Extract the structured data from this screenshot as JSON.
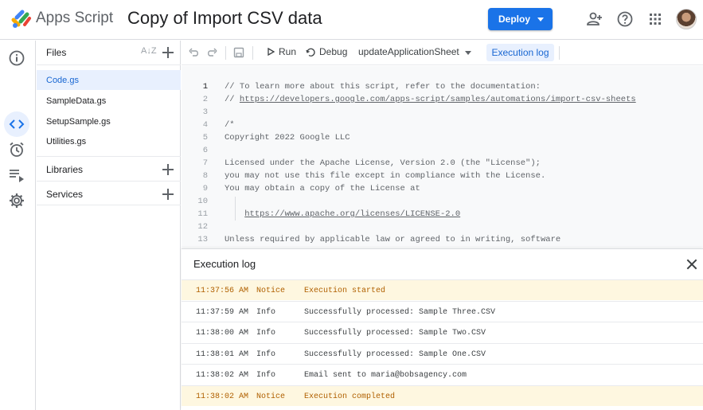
{
  "header": {
    "brand": "Apps Script",
    "project_title": "Copy of Import CSV data",
    "deploy_label": "Deploy"
  },
  "files_panel": {
    "title": "Files",
    "files": [
      "Code.gs",
      "SampleData.gs",
      "SetupSample.gs",
      "Utilities.gs"
    ],
    "active_file": "Code.gs",
    "sections": [
      "Libraries",
      "Services"
    ]
  },
  "toolbar": {
    "run_label": "Run",
    "debug_label": "Debug",
    "function_name": "updateApplicationSheet",
    "exec_log_label": "Execution log"
  },
  "editor": {
    "current_line": 1,
    "lines": [
      {
        "n": "1",
        "text": "// To learn more about this script, refer to the documentation:"
      },
      {
        "n": "2",
        "text": "// ",
        "link": "https://developers.google.com/apps-script/samples/automations/import-csv-sheets"
      },
      {
        "n": "3",
        "text": ""
      },
      {
        "n": "4",
        "text": "/*"
      },
      {
        "n": "5",
        "text": "Copyright 2022 Google LLC"
      },
      {
        "n": "6",
        "text": ""
      },
      {
        "n": "7",
        "text": "Licensed under the Apache License, Version 2.0 (the \"License\");"
      },
      {
        "n": "8",
        "text": "you may not use this file except in compliance with the License."
      },
      {
        "n": "9",
        "text": "You may obtain a copy of the License at"
      },
      {
        "n": "10",
        "text": ""
      },
      {
        "n": "11",
        "text": "    ",
        "link": "https://www.apache.org/licenses/LICENSE-2.0"
      },
      {
        "n": "12",
        "text": ""
      },
      {
        "n": "13",
        "text": "Unless required by applicable law or agreed to in writing, software"
      }
    ]
  },
  "execution_log": {
    "title": "Execution log",
    "rows": [
      {
        "time": "11:37:56 AM",
        "level": "Notice",
        "message": "Execution started"
      },
      {
        "time": "11:37:59 AM",
        "level": "Info",
        "message": "Successfully processed: Sample Three.CSV"
      },
      {
        "time": "11:38:00 AM",
        "level": "Info",
        "message": "Successfully processed: Sample Two.CSV"
      },
      {
        "time": "11:38:01 AM",
        "level": "Info",
        "message": "Successfully processed: Sample One.CSV"
      },
      {
        "time": "11:38:02 AM",
        "level": "Info",
        "message": "Email sent to maria@bobsagency.com"
      },
      {
        "time": "11:38:02 AM",
        "level": "Notice",
        "message": "Execution completed"
      }
    ]
  },
  "icons": {
    "rail": [
      "info-icon",
      "code-icon",
      "alarm-clock-icon",
      "executions-icon",
      "gear-icon"
    ],
    "header": [
      "add-person-icon",
      "help-icon",
      "apps-grid-icon"
    ]
  },
  "colors": {
    "accent": "#1a73e8",
    "active_bg": "#e8f0fe",
    "notice_bg": "#fef7e0",
    "notice_text": "#b06000"
  }
}
